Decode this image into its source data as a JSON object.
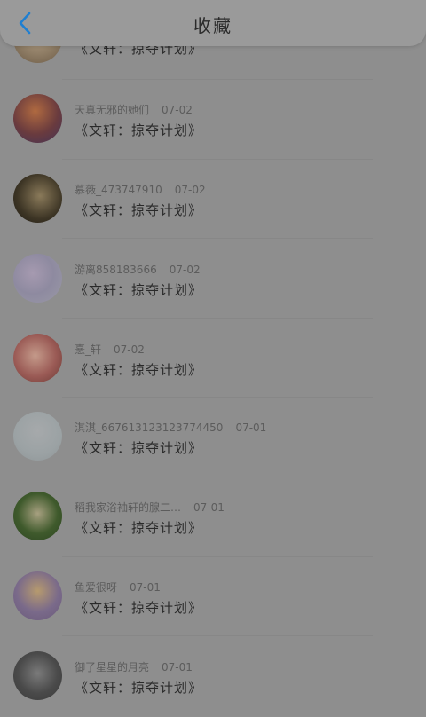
{
  "header": {
    "title": "收藏",
    "back_icon": "chevron-left-icon",
    "accent_color": "#1f7fd1"
  },
  "items": [
    {
      "user": "",
      "date": "",
      "work": "《文轩：掠夺计划》",
      "avatar_icon": "avatar-photo"
    },
    {
      "user": "天真无邪的她们",
      "date": "07-02",
      "work": "《文轩：掠夺计划》",
      "avatar_icon": "avatar-photo"
    },
    {
      "user": "慕薇_473747910",
      "date": "07-02",
      "work": "《文轩：掠夺计划》",
      "avatar_icon": "avatar-photo"
    },
    {
      "user": "游离858183666",
      "date": "07-02",
      "work": "《文轩：掠夺计划》",
      "avatar_icon": "avatar-photo"
    },
    {
      "user": "憙_轩",
      "date": "07-02",
      "work": "《文轩：掠夺计划》",
      "avatar_icon": "avatar-photo"
    },
    {
      "user": "淇淇_667613123123774450",
      "date": "07-01",
      "work": "《文轩：掠夺计划》",
      "avatar_icon": "avatar-photo"
    },
    {
      "user": "稻我家浴袖轩的腺二…",
      "date": "07-01",
      "work": "《文轩：掠夺计划》",
      "avatar_icon": "avatar-photo"
    },
    {
      "user": "鱼爱很呀",
      "date": "07-01",
      "work": "《文轩：掠夺计划》",
      "avatar_icon": "avatar-photo"
    },
    {
      "user": "御了星星的月亮",
      "date": "07-01",
      "work": "《文轩：掠夺计划》",
      "avatar_icon": "avatar-photo"
    }
  ]
}
